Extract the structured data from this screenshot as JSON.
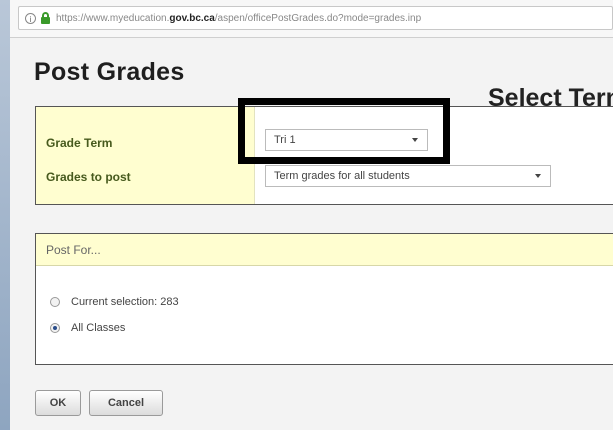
{
  "browser": {
    "url_prefix": "https://www.myeducation.",
    "url_domain": "gov.bc.ca",
    "url_suffix": "/aspen/officePostGrades.do?mode=grades.inp"
  },
  "page": {
    "title": "Post Grades"
  },
  "annotation": {
    "text": "Select Term"
  },
  "terms": {
    "grade_term_label": "Grade Term",
    "grade_term_value": "Tri 1",
    "grades_to_post_label": "Grades to post",
    "grades_to_post_value": "Term grades for all students"
  },
  "post_for": {
    "header": "Post For...",
    "options": [
      {
        "label": "Current selection: 283",
        "checked": false
      },
      {
        "label": "All Classes",
        "checked": true
      }
    ]
  },
  "actions": {
    "ok_label": "OK",
    "cancel_label": "Cancel"
  }
}
